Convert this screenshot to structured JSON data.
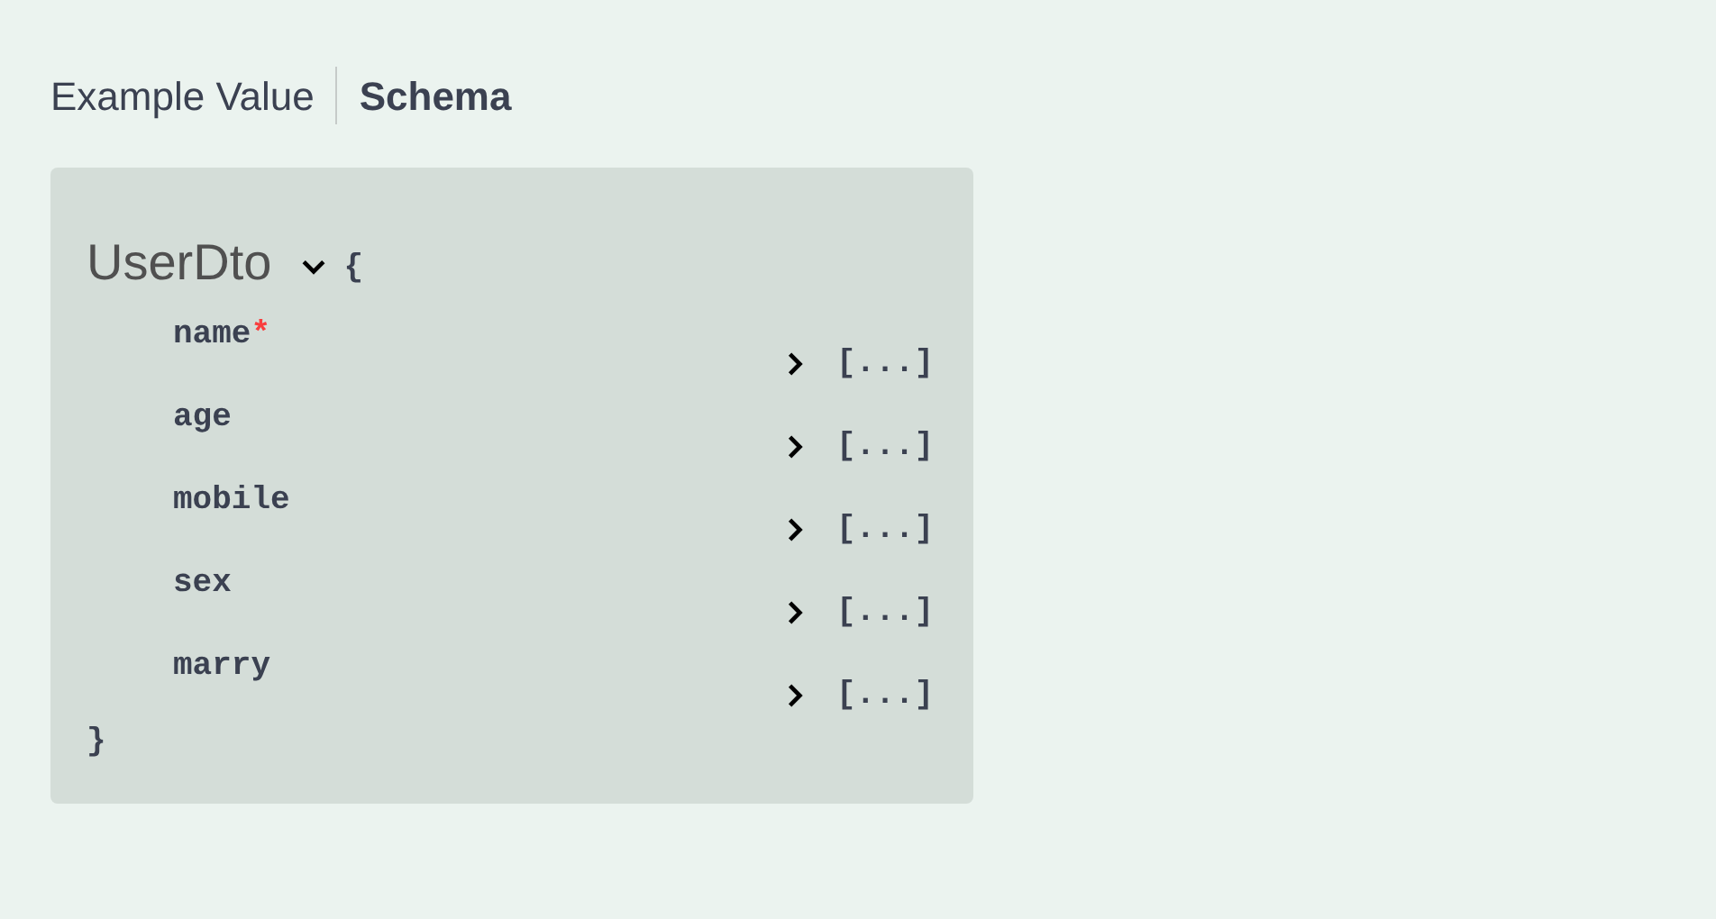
{
  "tabs": [
    {
      "label": "Example Value",
      "selected": false
    },
    {
      "label": "Schema",
      "selected": true
    }
  ],
  "model": {
    "title": "UserDto",
    "expanded": true,
    "open_brace": "{",
    "close_brace": "}",
    "properties": [
      {
        "name": "name",
        "required_mark": "*",
        "expanded": false,
        "value": "[...]"
      },
      {
        "name": "age",
        "expanded": false,
        "value": "[...]"
      },
      {
        "name": "mobile",
        "expanded": false,
        "value": "[...]"
      },
      {
        "name": "sex",
        "expanded": false,
        "value": "[...]"
      },
      {
        "name": "marry",
        "expanded": false,
        "value": "[...]"
      }
    ]
  }
}
